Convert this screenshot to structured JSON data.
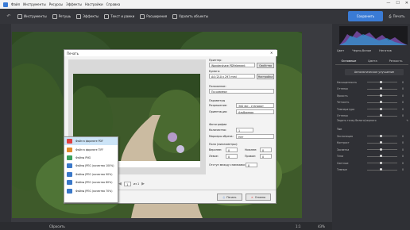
{
  "menu": {
    "items": [
      "Файл",
      "Инструменты",
      "Ресурсы",
      "Эффекты",
      "Настройки",
      "Справка"
    ],
    "win_controls": [
      "—",
      "☐",
      "✕"
    ]
  },
  "toolbar": {
    "tools": [
      {
        "label": "Инструменты",
        "icon": "tools-icon"
      },
      {
        "label": "Ретушь",
        "icon": "retouch-icon"
      },
      {
        "label": "Эффекты",
        "icon": "effects-icon"
      },
      {
        "label": "Текст и рамки",
        "icon": "text-icon"
      },
      {
        "label": "Расширения",
        "icon": "extensions-icon"
      },
      {
        "label": "Удалить объекты",
        "icon": "eraser-icon"
      }
    ],
    "save_label": "Сохранить",
    "print_label": "Печать"
  },
  "right_panel": {
    "mode_tabs": [
      "Цвет",
      "Черно-белое",
      "Негатив"
    ],
    "sub_tabs": [
      "Основные",
      "Цвета",
      "Резкость"
    ],
    "auto_label": "Автоматическое улучшение",
    "sliders": [
      {
        "label": "Насыщенность",
        "value": "0",
        "pos": 0.45
      },
      {
        "label": "Оттенок",
        "value": "0",
        "pos": 0.45
      },
      {
        "label": "Яркость",
        "value": "0",
        "pos": 0.45
      },
      {
        "label": "Четкость",
        "value": "0",
        "pos": 0.45
      },
      {
        "label": "Температура",
        "value": "0",
        "pos": 0.45
      },
      {
        "label": "Оттенок",
        "value": "0",
        "pos": 0.45
      }
    ],
    "eyedrop_label": "Задать точку белого/черного",
    "tone_label": "Тон",
    "tone_sliders": [
      {
        "label": "Экспозиция",
        "value": "0",
        "pos": 0.45
      },
      {
        "label": "Контраст",
        "value": "0",
        "pos": 0.45
      },
      {
        "label": "Засветка",
        "value": "0",
        "pos": 0.45
      },
      {
        "label": "Тени",
        "value": "0",
        "pos": 0.45
      },
      {
        "label": "Светлые",
        "value": "0",
        "pos": 0.45
      },
      {
        "label": "Темные",
        "value": "0",
        "pos": 0.45
      }
    ]
  },
  "bottom": {
    "left_label": "Сбросить",
    "zoom": "1:1",
    "zoom_pct": "43%"
  },
  "dialog": {
    "title": "Печать",
    "printer_label": "Принтер:",
    "printer_value": "Wondershare PDFelement",
    "printer_props": "Свойства",
    "paper_label": "Бумага:",
    "paper_value": "A4 (210 x 297 mm)",
    "paper_settings": "Настройка",
    "position_label": "Положение:",
    "position_value": "По размеру",
    "params_label": "Параметры",
    "resolution_label": "Разрешение:",
    "resolution_value": "300 dpi - стандарт",
    "orientation_label": "Ориентация:",
    "orientation_value": "Альбомная",
    "photos_label": "Фотографии",
    "count_label": "Количество:",
    "count_value": "1",
    "markers_label": "Маркеры обреза:",
    "markers_value": "Нет",
    "margins_label": "Поля (миллиметры):",
    "top_label": "Верхнее:",
    "top_value": "0",
    "bottom_label": "Нижнее:",
    "bottom_value": "0",
    "left_label": "Левое:",
    "left_value": "0",
    "right_label": "Правое:",
    "right_value": "0",
    "gap_label": "Отступ между снимками:",
    "gap_value": "0",
    "page_value": "1",
    "page_of": "из 1",
    "print_button": "Печать",
    "cancel_button": "Отмена"
  },
  "dropdown": {
    "items": [
      {
        "label": "Файл в формате PDF",
        "color": "#e04040",
        "selected": true
      },
      {
        "label": "Файл в формате TIFF",
        "color": "#e08a2a",
        "selected": false
      },
      {
        "label": "Файлы PNG",
        "color": "#3aa05a",
        "selected": false
      },
      {
        "label": "Файлы JPEG (качество 100%)",
        "color": "#3a78c8",
        "selected": false
      },
      {
        "label": "Файлы JPEG (качество 90%)",
        "color": "#3a78c8",
        "selected": false
      },
      {
        "label": "Файлы JPEG (качество 80%)",
        "color": "#3a78c8",
        "selected": false
      },
      {
        "label": "Файлы JPEG (качество 70%)",
        "color": "#3a78c8",
        "selected": false
      }
    ]
  }
}
